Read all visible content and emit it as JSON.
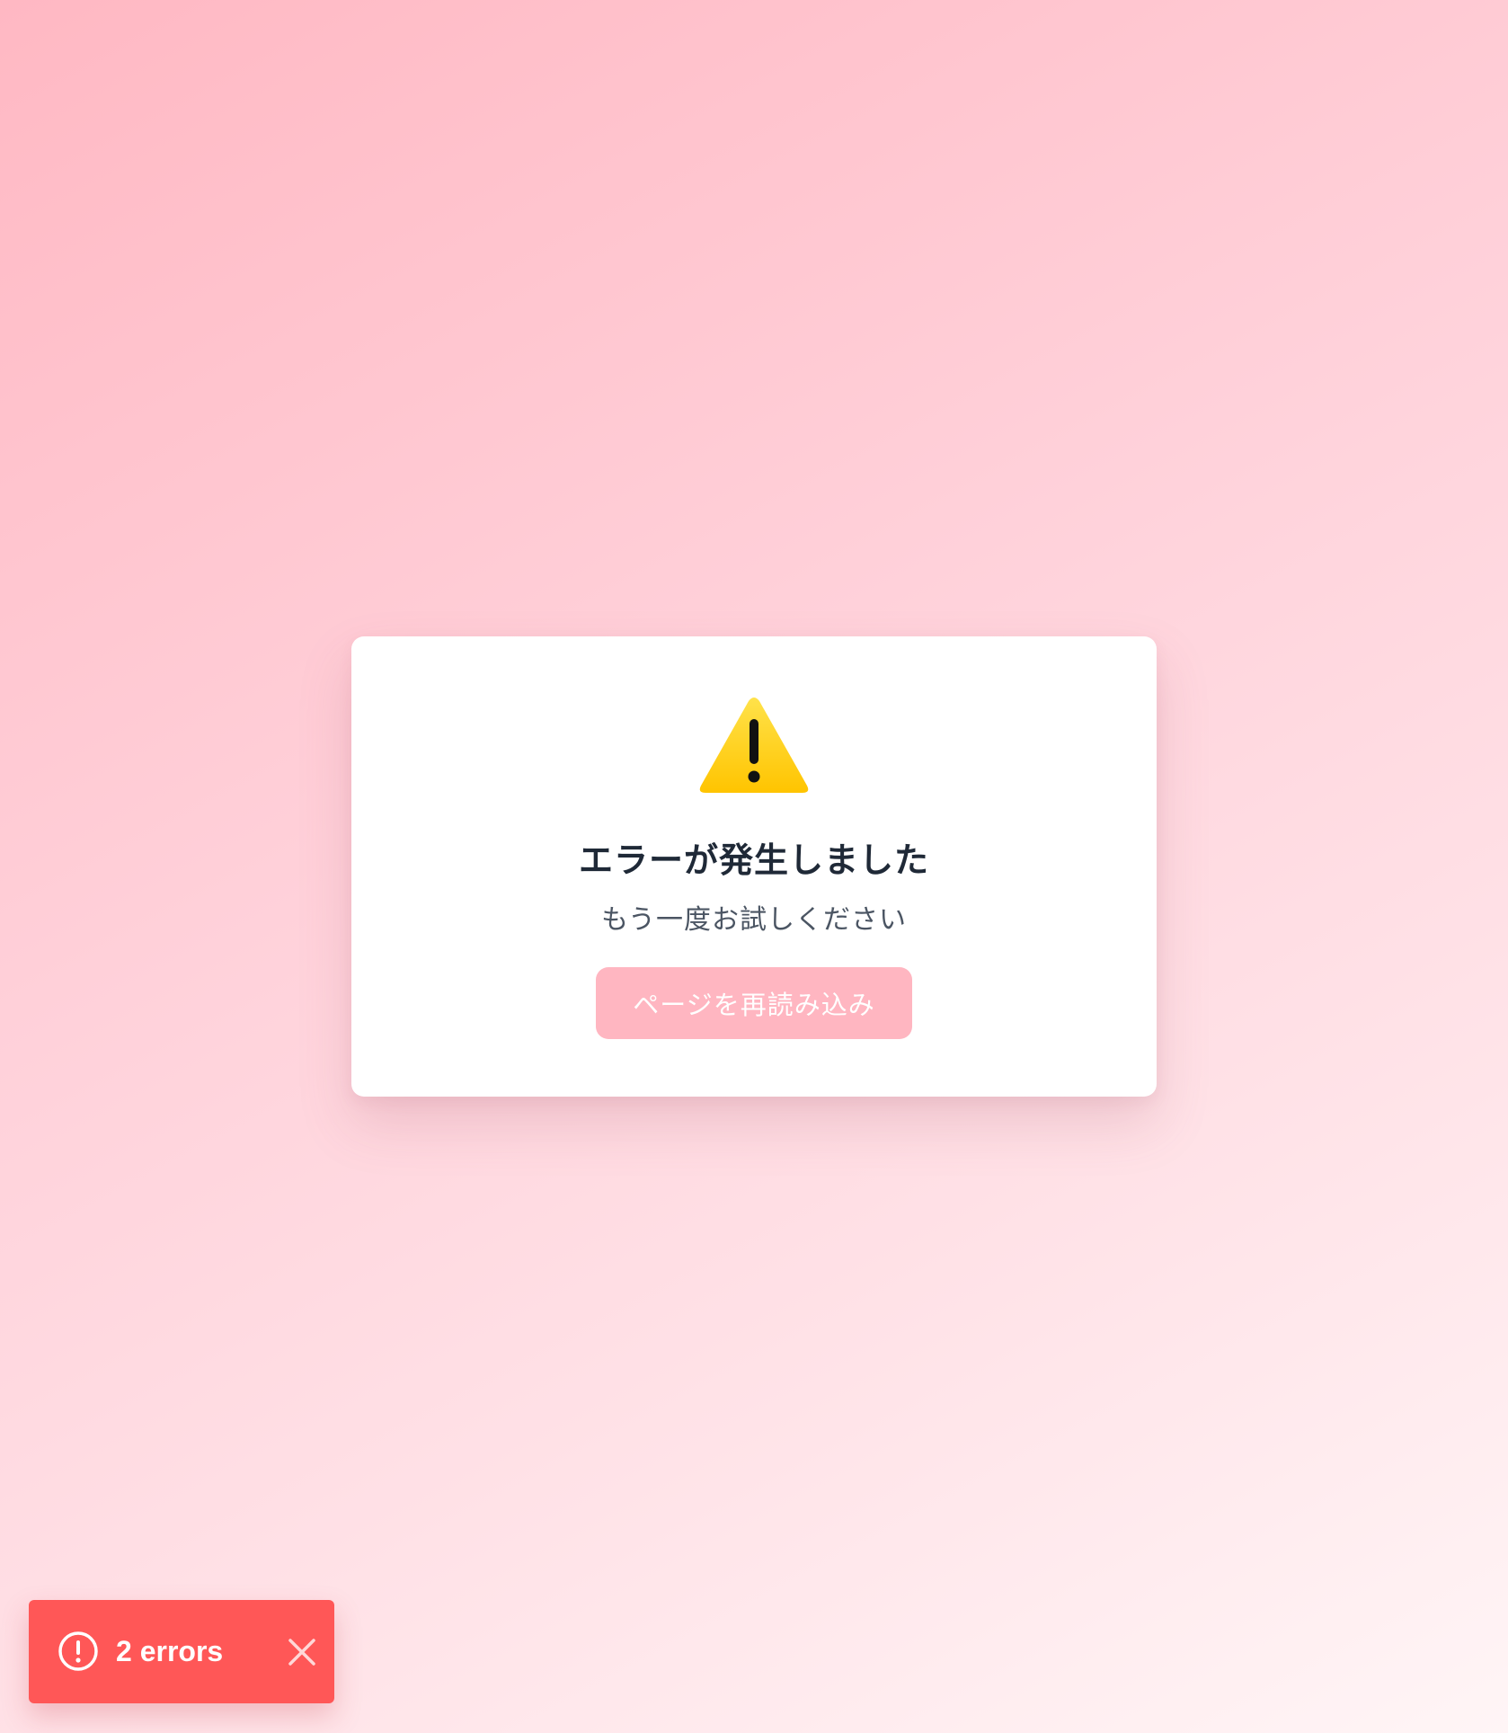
{
  "error_card": {
    "icon": "warning-icon",
    "title": "エラーが発生しました",
    "message": "もう一度お試しください",
    "reload_button_label": "ページを再読み込み"
  },
  "error_toast": {
    "icon": "alert-circle-icon",
    "label": "2 errors",
    "close_icon": "close-icon"
  },
  "colors": {
    "toast_background": "#ff5757",
    "button_background": "#ffb6c1",
    "title_text": "#1f2937",
    "message_text": "#4b5563",
    "warning_yellow": "#ffcc00"
  }
}
